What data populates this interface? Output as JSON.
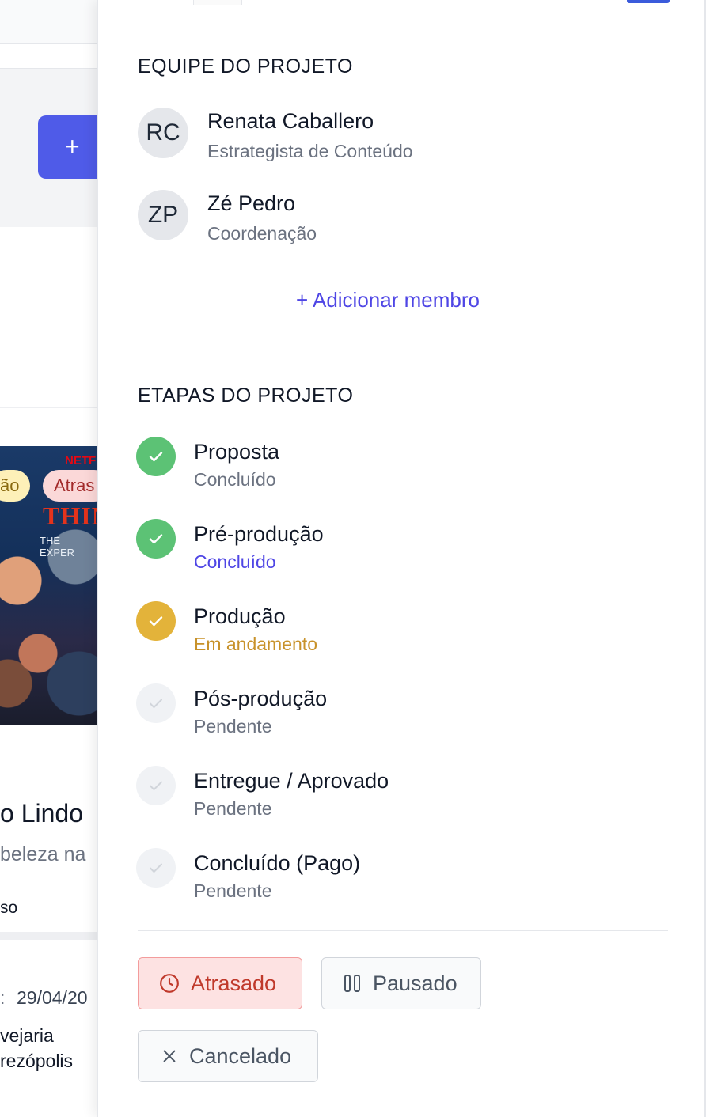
{
  "background": {
    "add_symbol": "+",
    "badges": [
      "ão",
      "Atras"
    ],
    "poster": {
      "brand": "NETFL",
      "title_fragment": "THIN",
      "subtitle_fragment": "THE EXPER"
    },
    "card_title": "o Lindo",
    "card_subtitle": "beleza na",
    "card_meta": "so",
    "date_label": ":",
    "date_value": "29/04/20",
    "location_line1": "vejaria",
    "location_line2": "rezópolis"
  },
  "team": {
    "title": "EQUIPE DO PROJETO",
    "members": [
      {
        "initials": "RC",
        "name": "Renata Caballero",
        "role": "Estrategista de Conteúdo"
      },
      {
        "initials": "ZP",
        "name": "Zé Pedro",
        "role": "Coordenação"
      }
    ],
    "add_member_label": "+ Adicionar membro"
  },
  "stages": {
    "title": "ETAPAS DO PROJETO",
    "items": [
      {
        "name": "Proposta",
        "status": "Concluído",
        "state": "done"
      },
      {
        "name": "Pré-produção",
        "status": "Concluído",
        "state": "done-link"
      },
      {
        "name": "Produção",
        "status": "Em andamento",
        "state": "in-progress"
      },
      {
        "name": "Pós-produção",
        "status": "Pendente",
        "state": "pending"
      },
      {
        "name": "Entregue / Aprovado",
        "status": "Pendente",
        "state": "pending"
      },
      {
        "name": "Concluído (Pago)",
        "status": "Pendente",
        "state": "pending"
      }
    ]
  },
  "status_actions": {
    "late_label": "Atrasado",
    "paused_label": "Pausado",
    "cancelled_label": "Cancelado"
  },
  "colors": {
    "accent": "#4f46e5",
    "done": "#5cc275",
    "in_progress": "#e3b33a",
    "in_progress_text": "#c8922a",
    "pending": "#f0f2f5",
    "late_bg": "#fde2e2",
    "late_border": "#f39c9c",
    "late_text": "#c0392b"
  }
}
